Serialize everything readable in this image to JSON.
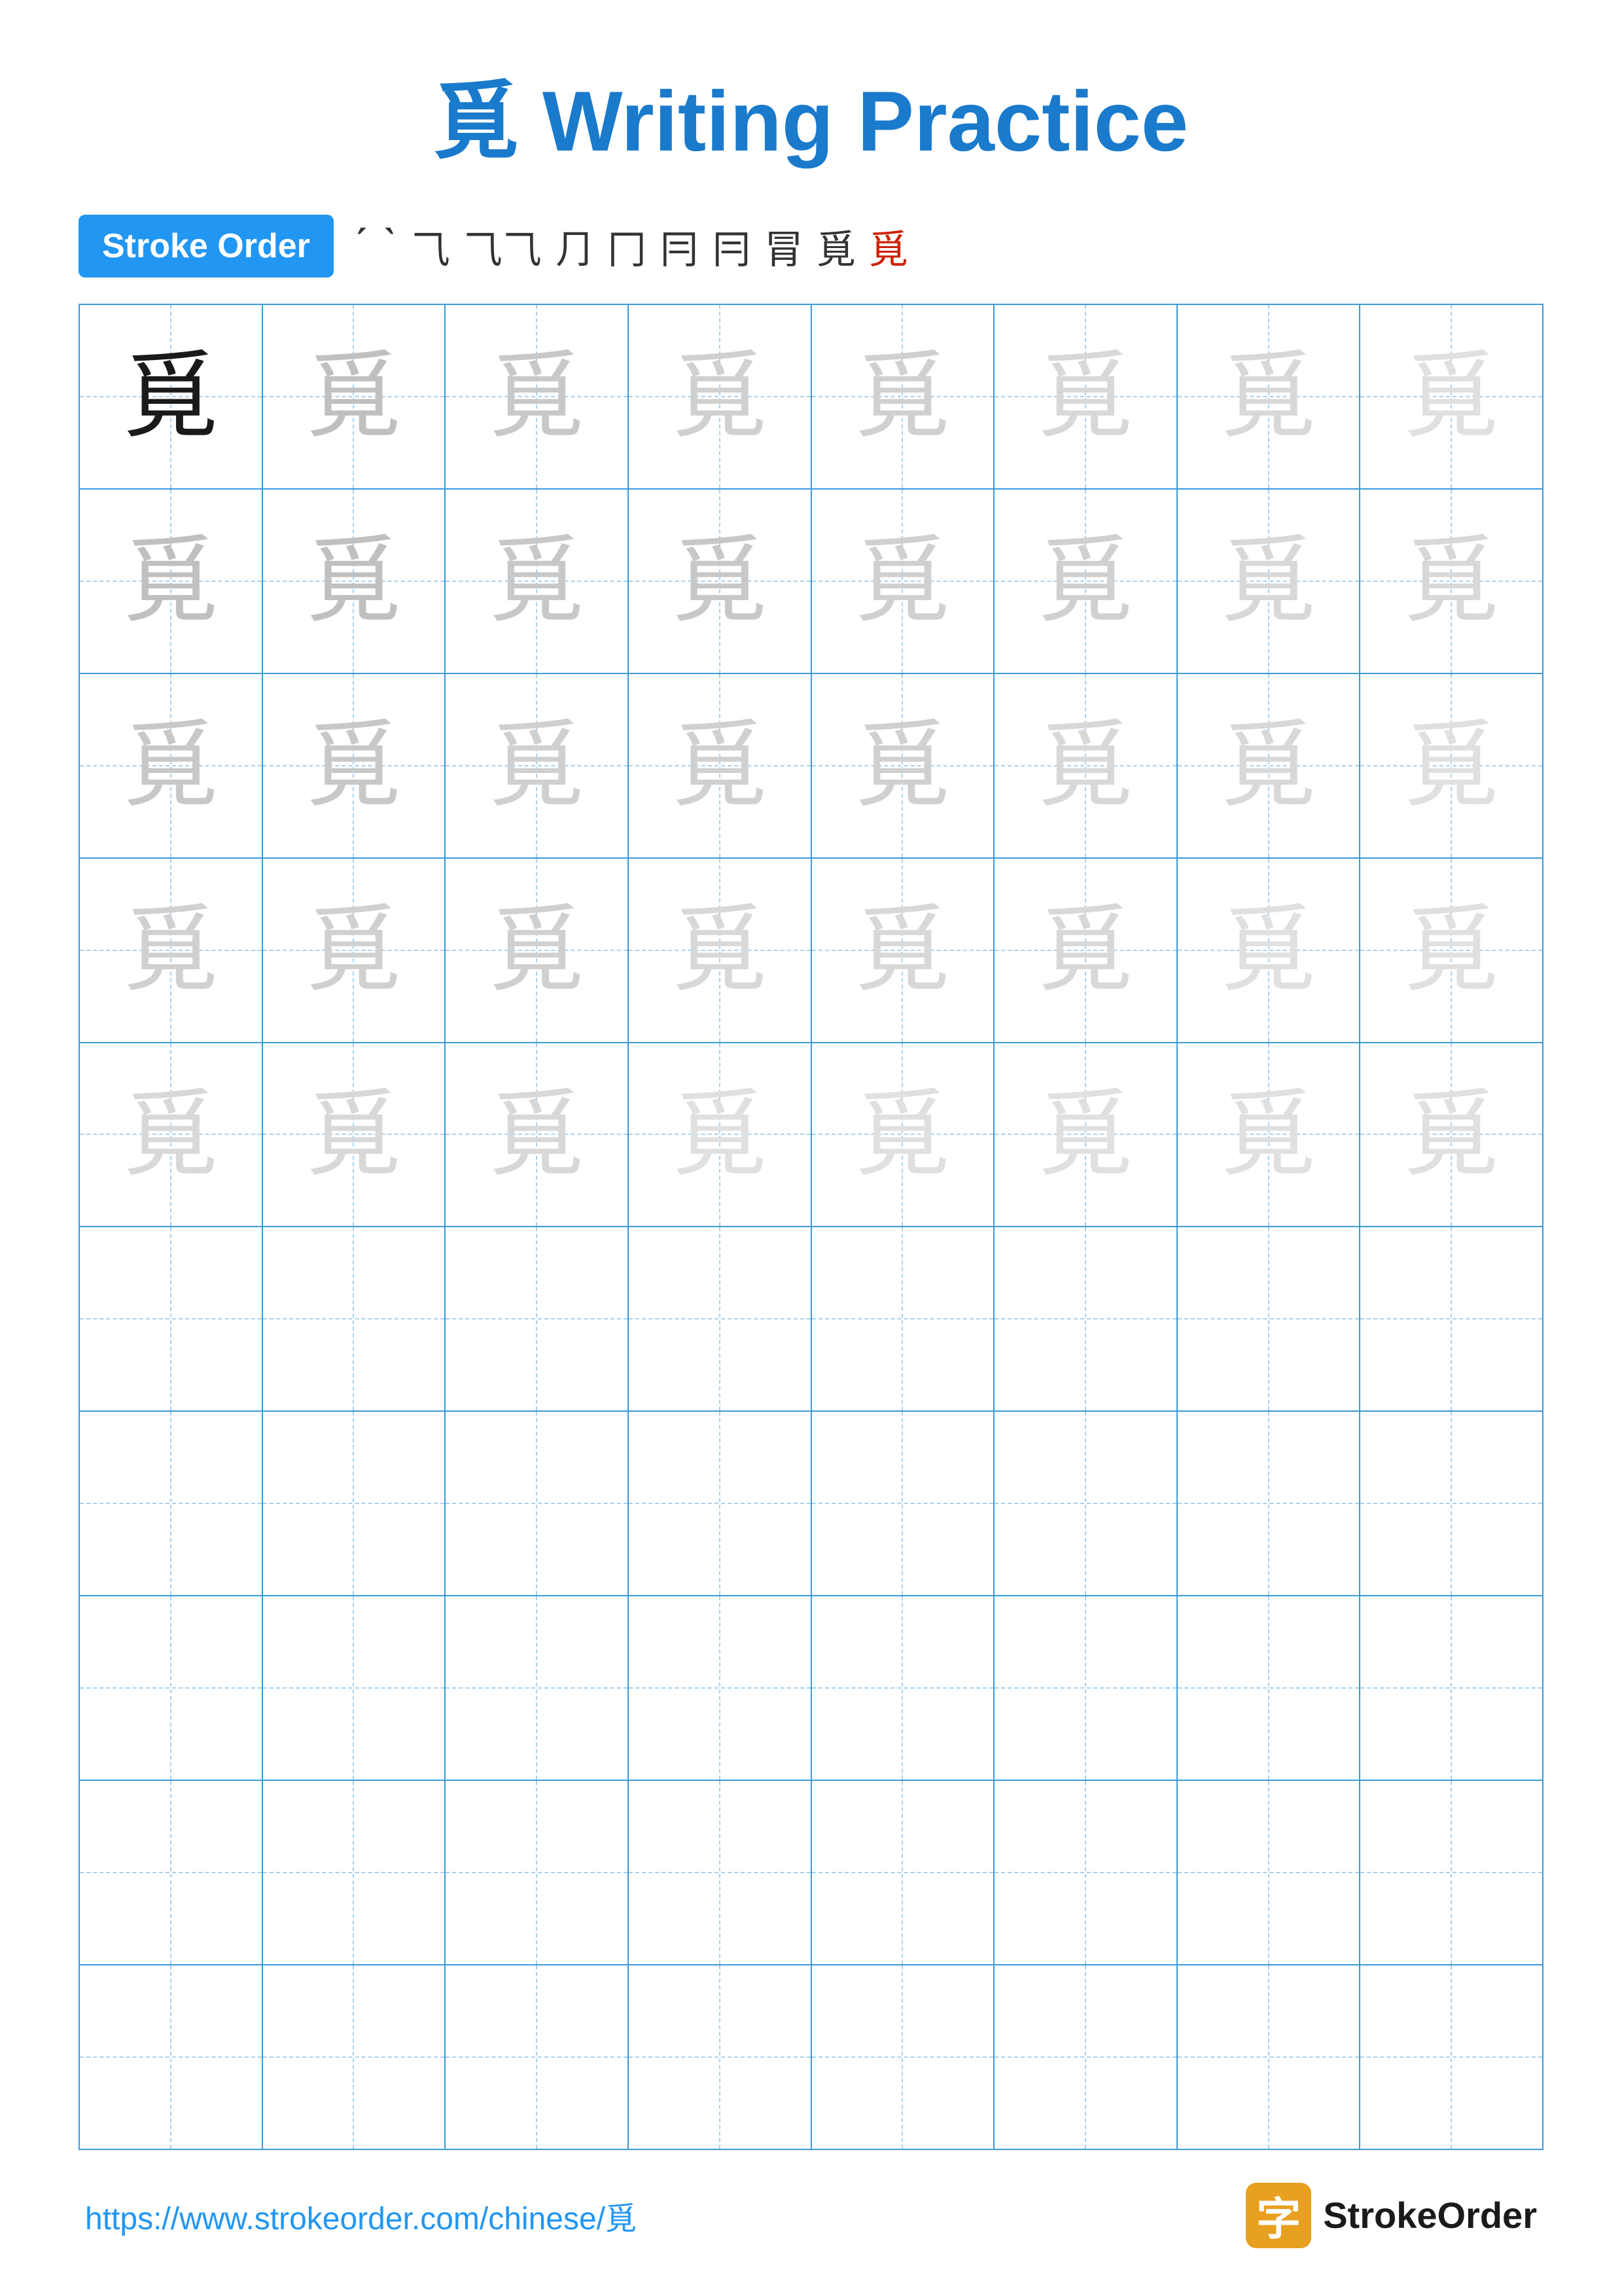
{
  "title": {
    "char": "覓",
    "text": " Writing Practice"
  },
  "stroke_order": {
    "badge_label": "Stroke Order",
    "strokes": [
      "ˊ",
      "ˋ",
      "⺄",
      "⺄⺄",
      "⺆",
      "冂",
      "冃",
      "冃",
      "冐",
      "覓",
      "覓"
    ]
  },
  "grid": {
    "character": "覓",
    "rows": 10,
    "cols": 8
  },
  "footer": {
    "url": "https://www.strokeorder.com/chinese/覓",
    "logo_text": "StrokeOrder",
    "logo_char": "字"
  }
}
